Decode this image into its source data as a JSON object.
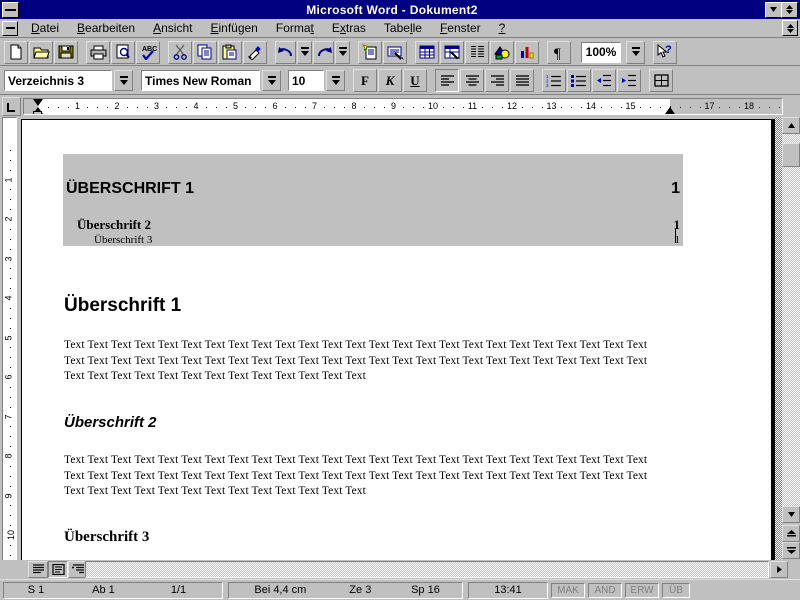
{
  "window": {
    "title": "Microsoft Word - Dokument2",
    "sysmenu_icon": "system-menu-icon",
    "minimize_icon": "minimize-icon",
    "maximize_icon": "maximize-icon"
  },
  "menu": {
    "items": [
      {
        "label": "Datei",
        "accel": "D"
      },
      {
        "label": "Bearbeiten",
        "accel": "B"
      },
      {
        "label": "Ansicht",
        "accel": "A"
      },
      {
        "label": "Einfügen",
        "accel": "E"
      },
      {
        "label": "Format",
        "accel": "t"
      },
      {
        "label": "Extras",
        "accel": "x"
      },
      {
        "label": "Tabelle",
        "accel": "l"
      },
      {
        "label": "Fenster",
        "accel": "F"
      },
      {
        "label": "?",
        "accel": ""
      }
    ]
  },
  "toolbar_standard": {
    "buttons": [
      {
        "name": "new-document-icon",
        "tip": "Neu"
      },
      {
        "name": "open-folder-icon",
        "tip": "Öffnen"
      },
      {
        "name": "save-disk-icon",
        "tip": "Speichern"
      },
      {
        "name": "print-icon",
        "tip": "Drucken"
      },
      {
        "name": "print-preview-icon",
        "tip": "Seitenansicht"
      },
      {
        "name": "spellcheck-abc-icon",
        "tip": "Rechtschreibung"
      },
      {
        "name": "cut-scissors-icon",
        "tip": "Ausschneiden"
      },
      {
        "name": "copy-icon",
        "tip": "Kopieren"
      },
      {
        "name": "paste-clipboard-icon",
        "tip": "Einfügen"
      },
      {
        "name": "format-painter-brush-icon",
        "tip": "Format übertragen"
      },
      {
        "name": "undo-icon",
        "tip": "Rückgängig"
      },
      {
        "name": "undo-dropdown-icon",
        "tip": "Rückgängig Liste"
      },
      {
        "name": "redo-icon",
        "tip": "Wiederherstellen"
      },
      {
        "name": "redo-dropdown-icon",
        "tip": "Wiederherstellen Liste"
      },
      {
        "name": "autotext-icon",
        "tip": "AutoText"
      },
      {
        "name": "autoformat-icon",
        "tip": "AutoFormat"
      },
      {
        "name": "insert-table-icon",
        "tip": "Tabelle einfügen"
      },
      {
        "name": "insert-excel-table-icon",
        "tip": "Excel-Tabelle einfügen"
      },
      {
        "name": "columns-icon",
        "tip": "Spalten"
      },
      {
        "name": "drawing-icon",
        "tip": "Zeichnen"
      },
      {
        "name": "chart-icon",
        "tip": "Diagramm"
      },
      {
        "name": "show-paragraph-marks-icon",
        "tip": "Einblenden/Ausblenden"
      }
    ],
    "zoom_value": "100%",
    "zoom_dropdown_icon": "chevron-down-icon",
    "help_button": {
      "name": "help-arrow-icon",
      "tip": "Direkthilfe"
    }
  },
  "toolbar_formatting": {
    "style": {
      "value": "Verzeichnis 3",
      "dropdown_icon": "chevron-down-icon"
    },
    "font": {
      "value": "Times New Roman",
      "dropdown_icon": "chevron-down-icon"
    },
    "size": {
      "value": "10",
      "dropdown_icon": "chevron-down-icon"
    },
    "bold_label": "F",
    "italic_label": "K",
    "underline_label": "U",
    "buttons": [
      {
        "name": "align-left-icon"
      },
      {
        "name": "align-center-icon"
      },
      {
        "name": "align-right-icon"
      },
      {
        "name": "align-justify-icon"
      },
      {
        "name": "numbered-list-icon"
      },
      {
        "name": "bulleted-list-icon"
      },
      {
        "name": "decrease-indent-icon"
      },
      {
        "name": "increase-indent-icon"
      },
      {
        "name": "borders-icon"
      }
    ]
  },
  "ruler": {
    "tab_selector_icon": "tab-left-icon",
    "unit": "cm",
    "horizontal_numbers": [
      1,
      2,
      3,
      4,
      5,
      6,
      7,
      8,
      9,
      10,
      11,
      12,
      13,
      14,
      15,
      17,
      18
    ],
    "vertical_numbers": [
      1,
      2,
      3,
      4,
      5,
      6,
      7,
      8,
      9,
      10
    ],
    "left_indent_cm": 0,
    "right_indent_cm": 16
  },
  "document": {
    "toc_heading_1": {
      "text": "ÜBERSCHRIFT 1",
      "page": "1"
    },
    "toc_heading_2": {
      "text": "Überschrift 2",
      "page": "1"
    },
    "toc_heading_3": {
      "text": "Überschrift 3",
      "page": "1"
    },
    "heading_1": "Überschrift 1",
    "heading_2": "Überschrift 2",
    "heading_3": "Überschrift 3",
    "body_paragraph_1": "Text Text Text Text Text Text Text Text Text Text Text Text Text Text Text Text Text Text Text Text Text Text Text Text Text Text Text Text Text Text Text Text Text Text Text Text Text Text Text Text Text Text Text Text Text Text Text Text Text Text Text Text Text Text Text Text Text Text Text Text Text Text Text",
    "body_paragraph_2": "Text Text Text Text Text Text Text Text Text Text Text Text Text Text Text Text Text Text Text Text Text Text Text Text Text Text Text Text Text Text Text Text Text Text Text Text Text Text Text Text Text Text Text Text Text Text Text Text Text Text Text Text Text Text Text Text Text Text Text Text Text Text Text"
  },
  "view_buttons": [
    {
      "name": "normal-view-icon"
    },
    {
      "name": "page-layout-view-icon"
    },
    {
      "name": "outline-view-icon"
    },
    {
      "name": "scroll-left-icon"
    }
  ],
  "scrollbar": {
    "up_icon": "scroll-up-icon",
    "down_icon": "scroll-down-icon",
    "prev_page_icon": "previous-page-icon",
    "next_page_icon": "next-page-icon"
  },
  "statusbar": {
    "page": "S 1",
    "section": "Ab 1",
    "page_of_total": "1/1",
    "position": "Bei 4,4 cm",
    "line": "Ze 3",
    "column": "Sp 16",
    "time": "13:41",
    "indicators": [
      "MAK",
      "AND",
      "ERW",
      "ÜB"
    ]
  },
  "colors": {
    "titlebar": "#000080",
    "titlebar_text": "#ffffff",
    "face": "#c0c0c0",
    "selection": "#c0c0c0",
    "page": "#ffffff",
    "shadow": "#808080"
  }
}
